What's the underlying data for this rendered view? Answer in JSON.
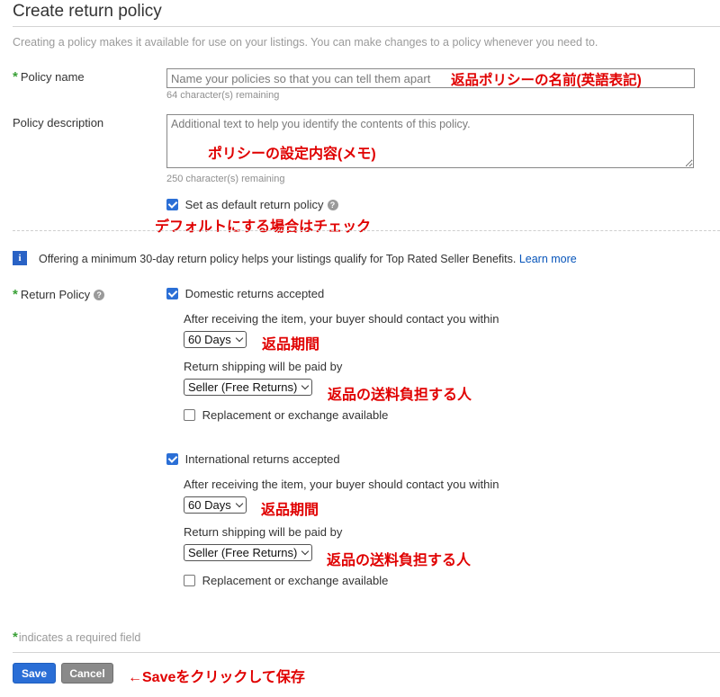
{
  "page": {
    "title": "Create return policy",
    "intro": "Creating a policy makes it available for use on your listings. You can make changes to a policy whenever you need to."
  },
  "policy_name": {
    "required_mark": "*",
    "label": "Policy name",
    "placeholder": "Name your policies so that you can tell them apart",
    "value": "",
    "remaining": "64 character(s) remaining",
    "annotation": "返品ポリシーの名前(英語表記)"
  },
  "policy_description": {
    "label": "Policy description",
    "placeholder": "Additional text to help you identify the contents of this policy.",
    "value": "",
    "remaining": "250 character(s) remaining",
    "annotation": "ポリシーの設定内容(メモ)"
  },
  "default_policy": {
    "label": "Set as default return policy",
    "checked": true,
    "help_icon": "question-circle-icon",
    "annotation": "デフォルトにする場合はチェック"
  },
  "info_banner": {
    "icon": "info-icon",
    "icon_glyph": "i",
    "text": "Offering a minimum 30-day return policy helps your listings qualify for Top Rated Seller Benefits. ",
    "link": "Learn more"
  },
  "return_policy": {
    "required_mark": "*",
    "label": "Return Policy",
    "help_icon": "question-circle-icon",
    "domestic": {
      "label": "Domestic returns accepted",
      "checked": true,
      "contact_label": "After receiving the item, your buyer should contact you within",
      "days_selected": "60 Days",
      "days_annotation": "返品期間",
      "shipping_label": "Return shipping will be paid by",
      "shipping_selected": "Seller (Free Returns)",
      "shipping_annotation": "返品の送料負担する人",
      "replacement_label": "Replacement or exchange available",
      "replacement_checked": false
    },
    "international": {
      "label": "International returns accepted",
      "checked": true,
      "contact_label": "After receiving the item, your buyer should contact you within",
      "days_selected": "60 Days",
      "days_annotation": "返品期間",
      "shipping_label": "Return shipping will be paid by",
      "shipping_selected": "Seller (Free Returns)",
      "shipping_annotation": "返品の送料負担する人",
      "replacement_label": "Replacement or exchange available",
      "replacement_checked": false
    }
  },
  "footer": {
    "required_mark": "*",
    "required_note": "indicates a required field",
    "save_label": "Save",
    "cancel_label": "Cancel",
    "save_annotation": "←Saveをクリックして保存"
  },
  "colors": {
    "accent_blue": "#2a6ed6",
    "required_green": "#3aa137",
    "annotation_red": "#e00000",
    "link_blue": "#0654ba"
  }
}
